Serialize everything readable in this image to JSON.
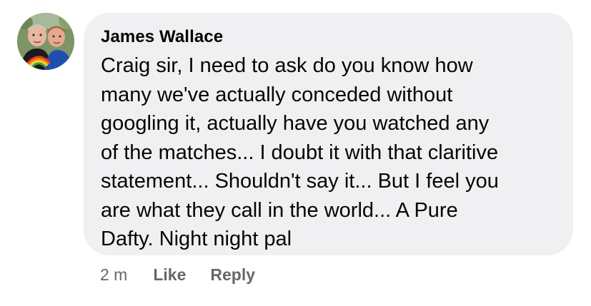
{
  "comment": {
    "author": "James Wallace",
    "text": "Craig sir, I need to ask do you know how\nmany we've actually conceded without\ngoogling it, actually have you watched any\nof the matches... I doubt it with that claritive\nstatement... Shouldn't say it... But I feel you\nare what they call in the world... A Pure\nDafty. Night night pal",
    "time": "2 m",
    "like_label": "Like",
    "reply_label": "Reply"
  },
  "colors": {
    "bubble": "#f0f0f2",
    "text": "#050505",
    "secondary": "#65676b"
  }
}
